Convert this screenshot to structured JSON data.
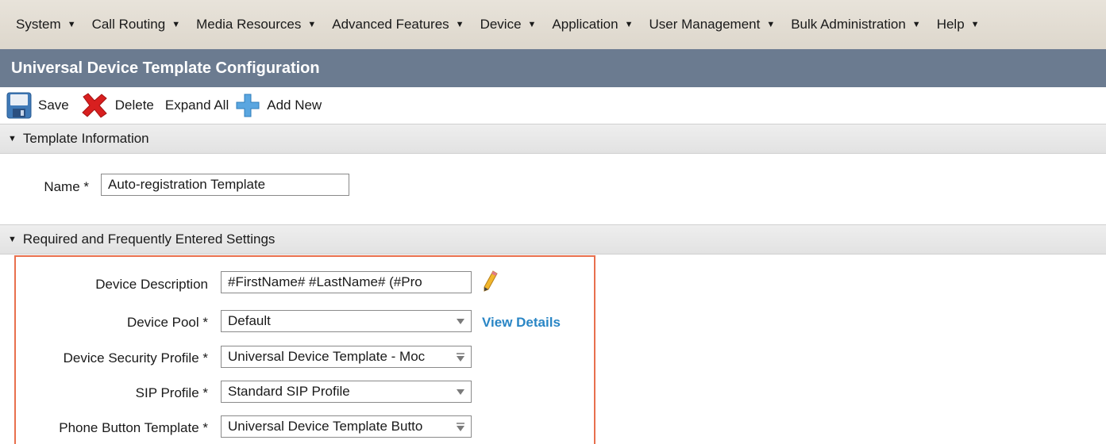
{
  "menubar": {
    "items": [
      {
        "label": "System"
      },
      {
        "label": "Call Routing"
      },
      {
        "label": "Media Resources"
      },
      {
        "label": "Advanced Features"
      },
      {
        "label": "Device"
      },
      {
        "label": "Application"
      },
      {
        "label": "User Management"
      },
      {
        "label": "Bulk Administration"
      },
      {
        "label": "Help"
      }
    ],
    "arrow": "▼"
  },
  "page": {
    "title": "Universal Device Template Configuration"
  },
  "toolbar": {
    "save_label": "Save",
    "delete_label": "Delete",
    "expand_all_label": "Expand All",
    "add_new_label": "Add New"
  },
  "template_info": {
    "header": "Template Information",
    "name_label": "Name *",
    "name_value": "Auto-registration Template"
  },
  "required_settings": {
    "header": "Required and Frequently Entered Settings",
    "device_description_label": "Device Description",
    "device_description_value": "#FirstName# #LastName# (#Pro",
    "device_pool_label": "Device Pool *",
    "device_pool_value": "Default",
    "view_details_label": "View Details",
    "device_security_profile_label": "Device Security Profile *",
    "device_security_profile_value": "Universal Device Template - Moc",
    "sip_profile_label": "SIP Profile *",
    "sip_profile_value": "Standard SIP Profile",
    "phone_button_template_label": "Phone Button Template *",
    "phone_button_template_value": "Universal Device Template Butto"
  },
  "colors": {
    "menubar_bg": "#e1dbd1",
    "titlebar_bg": "#6b7b90",
    "link": "#2a86c5",
    "highlight_border": "#e8704e",
    "delete_red": "#d81f1f",
    "add_blue": "#5aa6e0"
  }
}
